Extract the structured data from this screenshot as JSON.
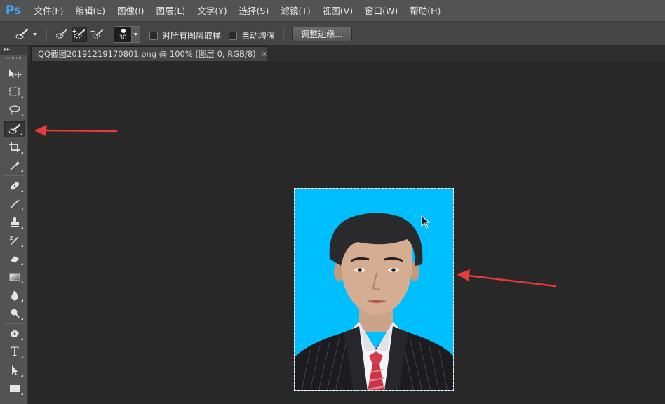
{
  "app": {
    "logo": "Ps"
  },
  "menu": [
    "文件(F)",
    "编辑(E)",
    "图像(I)",
    "图层(L)",
    "文字(Y)",
    "选择(S)",
    "滤镜(T)",
    "视图(V)",
    "窗口(W)",
    "帮助(H)"
  ],
  "options": {
    "brush_size": "30",
    "sample_all_layers": "对所有图层取样",
    "auto_enhance": "自动增强",
    "refine_edge": "调整边缘..."
  },
  "document": {
    "tab_label": "QQ截图20191219170801.png @ 100% (图层 0, RGB/8)",
    "close": "×"
  },
  "colors": {
    "photo_background": "#00bfff",
    "annotation_arrow": "#e83a3a",
    "canvas": "#282828",
    "ps_blue": "#3ea8ff"
  },
  "toolbox_icons": [
    "move-icon",
    "marquee-icon",
    "lasso-icon",
    "quick-selection-icon",
    "crop-icon",
    "eyedropper-icon",
    "healing-brush-icon",
    "brush-icon",
    "clone-stamp-icon",
    "history-brush-icon",
    "eraser-icon",
    "gradient-icon",
    "blur-icon",
    "dodge-icon",
    "pen-icon",
    "type-icon",
    "path-selection-icon",
    "rectangle-icon"
  ],
  "active_tool": "quick-selection-icon",
  "type_tool_glyph": "T"
}
